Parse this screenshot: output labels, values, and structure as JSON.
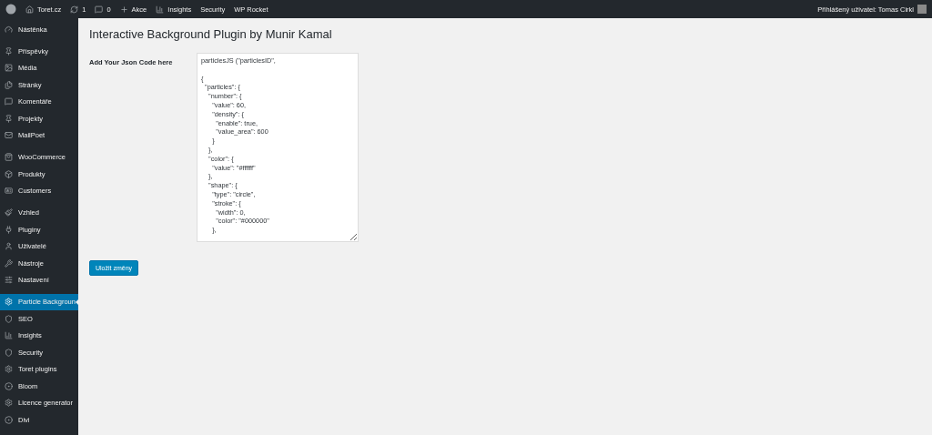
{
  "admin_bar": {
    "items": [
      {
        "kind": "logo"
      },
      {
        "kind": "site",
        "label": "Toret.cz"
      },
      {
        "kind": "updates",
        "label": "1"
      },
      {
        "kind": "comments",
        "label": "0"
      },
      {
        "kind": "new",
        "label": "Akce"
      },
      {
        "kind": "stats",
        "label": "Insights"
      },
      {
        "kind": "text",
        "label": "Security"
      },
      {
        "kind": "text",
        "label": "WP Rocket"
      }
    ],
    "user": "Přihlášený uživatel: Tomas Cirkl"
  },
  "sidebar": {
    "groups": [
      [
        {
          "label": "Nástěnka",
          "selected": false
        }
      ],
      [
        {
          "label": "Příspěvky",
          "selected": false
        },
        {
          "label": "Média",
          "selected": false
        },
        {
          "label": "Stránky",
          "selected": false
        },
        {
          "label": "Komentáře",
          "selected": false
        },
        {
          "label": "Projekty",
          "selected": false
        },
        {
          "label": "MailPoet",
          "selected": false
        }
      ],
      [
        {
          "label": "WooCommerce",
          "selected": false
        },
        {
          "label": "Produkty",
          "selected": false
        },
        {
          "label": "Customers",
          "selected": false
        }
      ],
      [
        {
          "label": "Vzhled",
          "selected": false
        },
        {
          "label": "Pluginy",
          "selected": false
        },
        {
          "label": "Uživatelé",
          "selected": false
        },
        {
          "label": "Nástroje",
          "selected": false
        },
        {
          "label": "Nastavení",
          "selected": false
        }
      ],
      [
        {
          "label": "Particle Backgroun",
          "selected": true
        },
        {
          "label": "SEO",
          "selected": false
        },
        {
          "label": "Insights",
          "selected": false
        },
        {
          "label": "Security",
          "selected": false
        },
        {
          "label": "Toret plugins",
          "selected": false
        },
        {
          "label": "Bloom",
          "selected": false
        },
        {
          "label": "Licence generator",
          "selected": false
        },
        {
          "label": "Divi",
          "selected": false
        }
      ]
    ]
  },
  "page": {
    "title": "Interactive Background Plugin by Munir Kamal",
    "field_label": "Add Your Json Code here",
    "code": "particlesJS (\"particlesID\",\n\n{\n  \"particles\": {\n    \"number\": {\n      \"value\": 60,\n      \"density\": {\n        \"enable\": true,\n        \"value_area\": 600\n      }\n    },\n    \"color\": {\n      \"value\": \"#ffffff\"\n    },\n    \"shape\": {\n      \"type\": \"circle\",\n      \"stroke\": {\n        \"width\": 0,\n        \"color\": \"#000000\"\n      },",
    "save_button": "Uložit změny"
  }
}
